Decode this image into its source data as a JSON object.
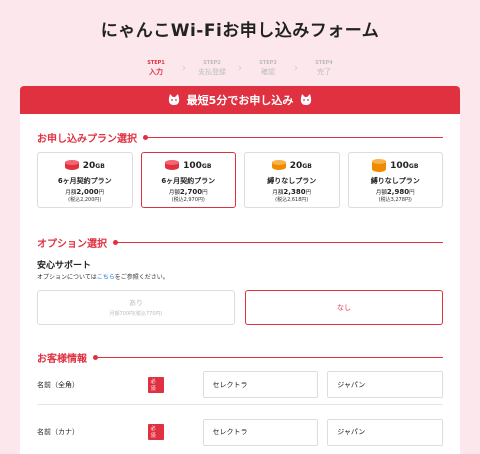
{
  "page": {
    "title": "にゃんこWi-Fiお申し込みフォーム"
  },
  "steps": [
    {
      "num": "STEP1",
      "label": "入力",
      "active": true
    },
    {
      "num": "STEP2",
      "label": "支払登録",
      "active": false
    },
    {
      "num": "STEP3",
      "label": "確認",
      "active": false
    },
    {
      "num": "STEP4",
      "label": "完了",
      "active": false
    }
  ],
  "banner": {
    "text": "最短5分でお申し込み"
  },
  "plan_section": {
    "title": "お申し込みプラン選択"
  },
  "plans": [
    {
      "capacity": "20",
      "unit": "GB",
      "name": "6ヶ月契約プラン",
      "price_prefix": "月額",
      "price": "2,000",
      "price_suffix": "円",
      "tax": "(税込2,200円)",
      "color": "#e03141",
      "selected": false
    },
    {
      "capacity": "100",
      "unit": "GB",
      "name": "6ヶ月契約プラン",
      "price_prefix": "月額",
      "price": "2,700",
      "price_suffix": "円",
      "tax": "(税込2,970円)",
      "color": "#e03141",
      "selected": true
    },
    {
      "capacity": "20",
      "unit": "GB",
      "name": "縛りなしプラン",
      "price_prefix": "月額",
      "price": "2,380",
      "price_suffix": "円",
      "tax": "(税込2,618円)",
      "color": "#f08a00",
      "selected": false
    },
    {
      "capacity": "100",
      "unit": "GB",
      "name": "縛りなしプラン",
      "price_prefix": "月額",
      "price": "2,980",
      "price_suffix": "円",
      "tax": "(税込3,278円)",
      "color": "#f08a00",
      "selected": false
    }
  ],
  "option_section": {
    "title": "オプション選択",
    "subtitle": "安心サポート",
    "note_prefix": "オプションについては",
    "note_link": "こちら",
    "note_suffix": "をご参照ください。",
    "yes_label": "あり",
    "yes_sub": "月額700円(税込770円)",
    "no_label": "なし"
  },
  "customer_section": {
    "title": "お客様情報"
  },
  "customer_rows": [
    {
      "label": "名前（全角）",
      "required": "必須",
      "first": "セレクトラ",
      "last": "ジャパン"
    },
    {
      "label": "名前（カナ）",
      "required": "必須",
      "first": "セレクトラ",
      "last": "ジャパン"
    }
  ],
  "colors": {
    "accent": "#e03141",
    "orange": "#f08a00",
    "background": "#fce8ec"
  }
}
